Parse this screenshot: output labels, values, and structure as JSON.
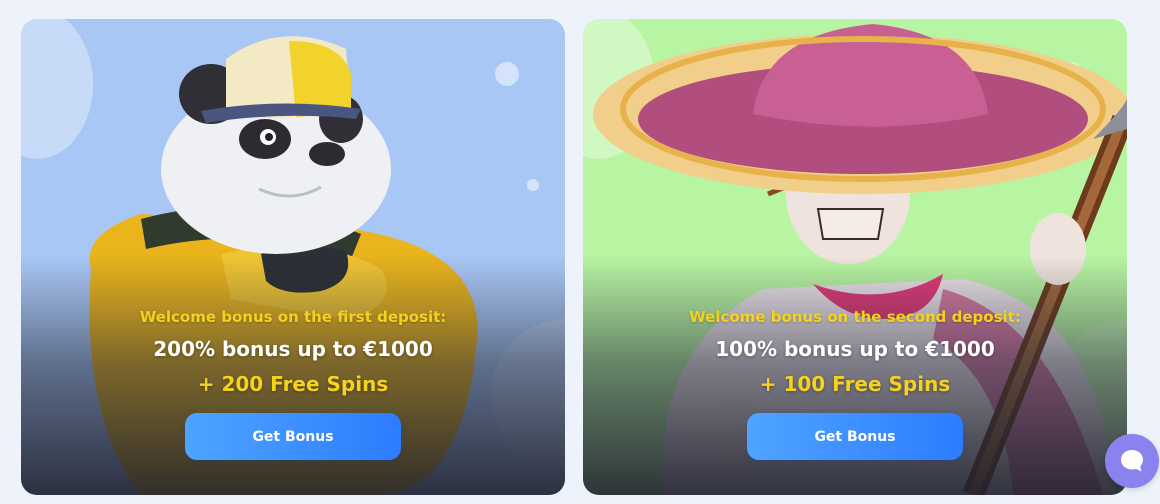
{
  "cards": [
    {
      "subtitle": "Welcome bonus on the first deposit:",
      "offer": "200% bonus up to €1000",
      "spins": "+ 200 Free Spins",
      "button_label": "Get Bonus",
      "background": "#a9c7f5",
      "character": "panda-character"
    },
    {
      "subtitle": "Welcome bonus on the second deposit:",
      "offer": "100% bonus up to €1000",
      "spins": "+ 100 Free Spins",
      "button_label": "Get Bonus",
      "background": "#b8f5a2",
      "character": "mariachi-skeleton-character"
    }
  ],
  "chat_widget": {
    "icon": "chat-bubble-icon",
    "color": "#8a82ef"
  },
  "colors": {
    "accent_yellow": "#f5d21e",
    "button_blue": "#2c7cff"
  }
}
